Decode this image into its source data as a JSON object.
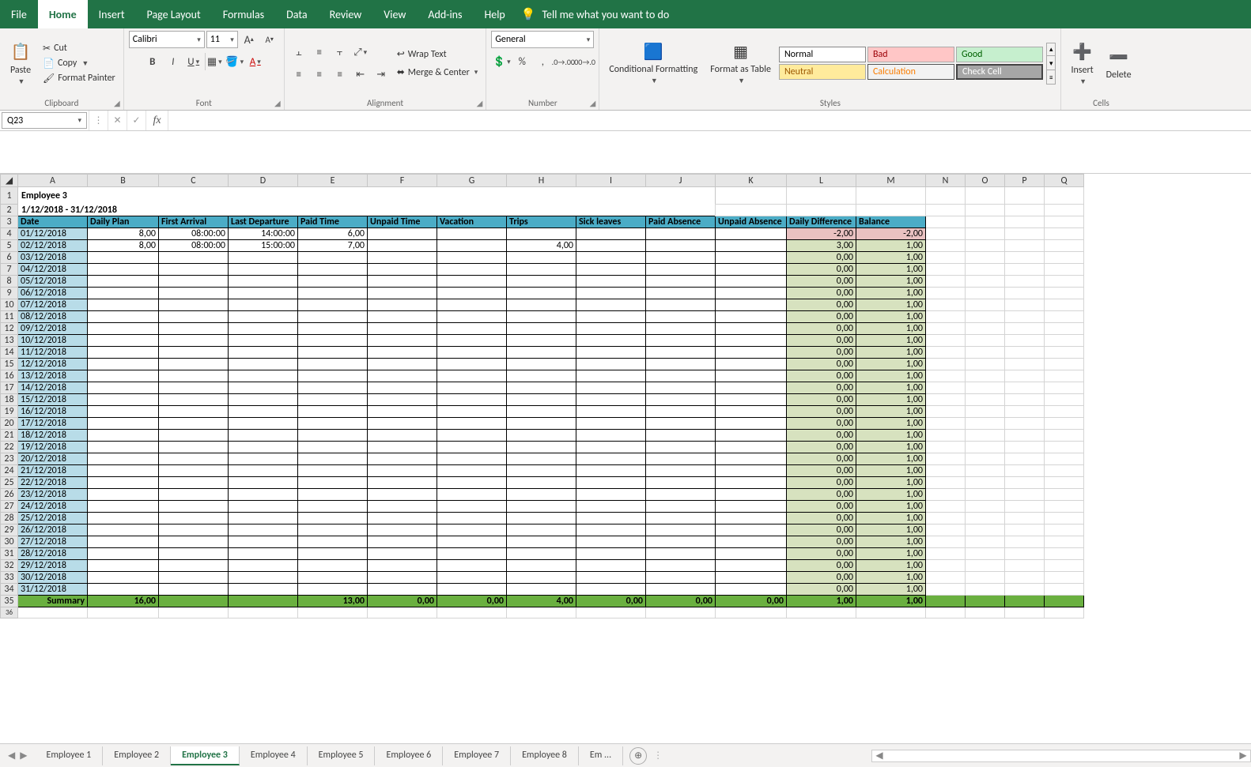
{
  "ribbon": {
    "tabs": [
      "File",
      "Home",
      "Insert",
      "Page Layout",
      "Formulas",
      "Data",
      "Review",
      "View",
      "Add-ins",
      "Help"
    ],
    "active_tab": "Home",
    "tellme": "Tell me what you want to do",
    "clipboard": {
      "paste": "Paste",
      "cut": "Cut",
      "copy": "Copy",
      "format_painter": "Format Painter",
      "label": "Clipboard"
    },
    "font": {
      "name": "Calibri",
      "size": "11",
      "label": "Font"
    },
    "alignment": {
      "wrap": "Wrap Text",
      "merge": "Merge & Center",
      "label": "Alignment"
    },
    "number": {
      "format": "General",
      "label": "Number"
    },
    "styles": {
      "cond": "Conditional Formatting",
      "table": "Format as Table",
      "cells": [
        "Normal",
        "Bad",
        "Good",
        "Neutral",
        "Calculation",
        "Check Cell"
      ],
      "label": "Styles"
    },
    "cells": {
      "insert": "Insert",
      "delete": "Delete",
      "label": "Cells"
    }
  },
  "namebox": "Q23",
  "sheet": {
    "title": "Employee 3",
    "period": "1/12/2018 - 31/12/2018",
    "columns": [
      "A",
      "B",
      "C",
      "D",
      "E",
      "F",
      "G",
      "H",
      "I",
      "J",
      "K",
      "L",
      "M",
      "N",
      "O",
      "P",
      "Q"
    ],
    "headers": [
      "Date",
      "Daily Plan",
      "First Arrival",
      "Last Departure",
      "Paid Time",
      "Unpaid Time",
      "Vacation",
      "Trips",
      "Sick leaves",
      "Paid Absence",
      "Unpaid Absence",
      "Daily Difference",
      "Balance"
    ],
    "rows": [
      {
        "n": 4,
        "date": "01/12/2018",
        "plan": "8,00",
        "arr": "08:00:00",
        "dep": "14:00:00",
        "paid": "6,00",
        "unpaid": "",
        "vac": "",
        "trip": "",
        "sick": "",
        "pabs": "",
        "uabs": "",
        "diff": "-2,00",
        "bal": "-2,00",
        "neg": true
      },
      {
        "n": 5,
        "date": "02/12/2018",
        "plan": "8,00",
        "arr": "08:00:00",
        "dep": "15:00:00",
        "paid": "7,00",
        "unpaid": "",
        "vac": "",
        "trip": "4,00",
        "sick": "",
        "pabs": "",
        "uabs": "",
        "diff": "3,00",
        "bal": "1,00"
      },
      {
        "n": 6,
        "date": "03/12/2018",
        "diff": "0,00",
        "bal": "1,00"
      },
      {
        "n": 7,
        "date": "04/12/2018",
        "diff": "0,00",
        "bal": "1,00"
      },
      {
        "n": 8,
        "date": "05/12/2018",
        "diff": "0,00",
        "bal": "1,00"
      },
      {
        "n": 9,
        "date": "06/12/2018",
        "diff": "0,00",
        "bal": "1,00"
      },
      {
        "n": 10,
        "date": "07/12/2018",
        "diff": "0,00",
        "bal": "1,00"
      },
      {
        "n": 11,
        "date": "08/12/2018",
        "diff": "0,00",
        "bal": "1,00"
      },
      {
        "n": 12,
        "date": "09/12/2018",
        "diff": "0,00",
        "bal": "1,00"
      },
      {
        "n": 13,
        "date": "10/12/2018",
        "diff": "0,00",
        "bal": "1,00"
      },
      {
        "n": 14,
        "date": "11/12/2018",
        "diff": "0,00",
        "bal": "1,00"
      },
      {
        "n": 15,
        "date": "12/12/2018",
        "diff": "0,00",
        "bal": "1,00"
      },
      {
        "n": 16,
        "date": "13/12/2018",
        "diff": "0,00",
        "bal": "1,00"
      },
      {
        "n": 17,
        "date": "14/12/2018",
        "diff": "0,00",
        "bal": "1,00"
      },
      {
        "n": 18,
        "date": "15/12/2018",
        "diff": "0,00",
        "bal": "1,00"
      },
      {
        "n": 19,
        "date": "16/12/2018",
        "diff": "0,00",
        "bal": "1,00"
      },
      {
        "n": 20,
        "date": "17/12/2018",
        "diff": "0,00",
        "bal": "1,00"
      },
      {
        "n": 21,
        "date": "18/12/2018",
        "diff": "0,00",
        "bal": "1,00"
      },
      {
        "n": 22,
        "date": "19/12/2018",
        "diff": "0,00",
        "bal": "1,00"
      },
      {
        "n": 23,
        "date": "20/12/2018",
        "diff": "0,00",
        "bal": "1,00"
      },
      {
        "n": 24,
        "date": "21/12/2018",
        "diff": "0,00",
        "bal": "1,00"
      },
      {
        "n": 25,
        "date": "22/12/2018",
        "diff": "0,00",
        "bal": "1,00"
      },
      {
        "n": 26,
        "date": "23/12/2018",
        "diff": "0,00",
        "bal": "1,00"
      },
      {
        "n": 27,
        "date": "24/12/2018",
        "diff": "0,00",
        "bal": "1,00"
      },
      {
        "n": 28,
        "date": "25/12/2018",
        "diff": "0,00",
        "bal": "1,00"
      },
      {
        "n": 29,
        "date": "26/12/2018",
        "diff": "0,00",
        "bal": "1,00"
      },
      {
        "n": 30,
        "date": "27/12/2018",
        "diff": "0,00",
        "bal": "1,00"
      },
      {
        "n": 31,
        "date": "28/12/2018",
        "diff": "0,00",
        "bal": "1,00"
      },
      {
        "n": 32,
        "date": "29/12/2018",
        "diff": "0,00",
        "bal": "1,00"
      },
      {
        "n": 33,
        "date": "30/12/2018",
        "diff": "0,00",
        "bal": "1,00"
      },
      {
        "n": 34,
        "date": "31/12/2018",
        "diff": "0,00",
        "bal": "1,00"
      }
    ],
    "summary": {
      "n": 35,
      "label": "Summary",
      "plan": "16,00",
      "arr": "",
      "dep": "",
      "paid": "13,00",
      "unpaid": "0,00",
      "vac": "0,00",
      "trip": "4,00",
      "sick": "0,00",
      "pabs": "0,00",
      "uabs": "0,00",
      "diff": "1,00",
      "bal": "1,00"
    }
  },
  "tabs": {
    "items": [
      "Employee 1",
      "Employee 2",
      "Employee 3",
      "Employee 4",
      "Employee 5",
      "Employee 6",
      "Employee 7",
      "Employee 8",
      "Em ..."
    ],
    "active": "Employee 3"
  }
}
